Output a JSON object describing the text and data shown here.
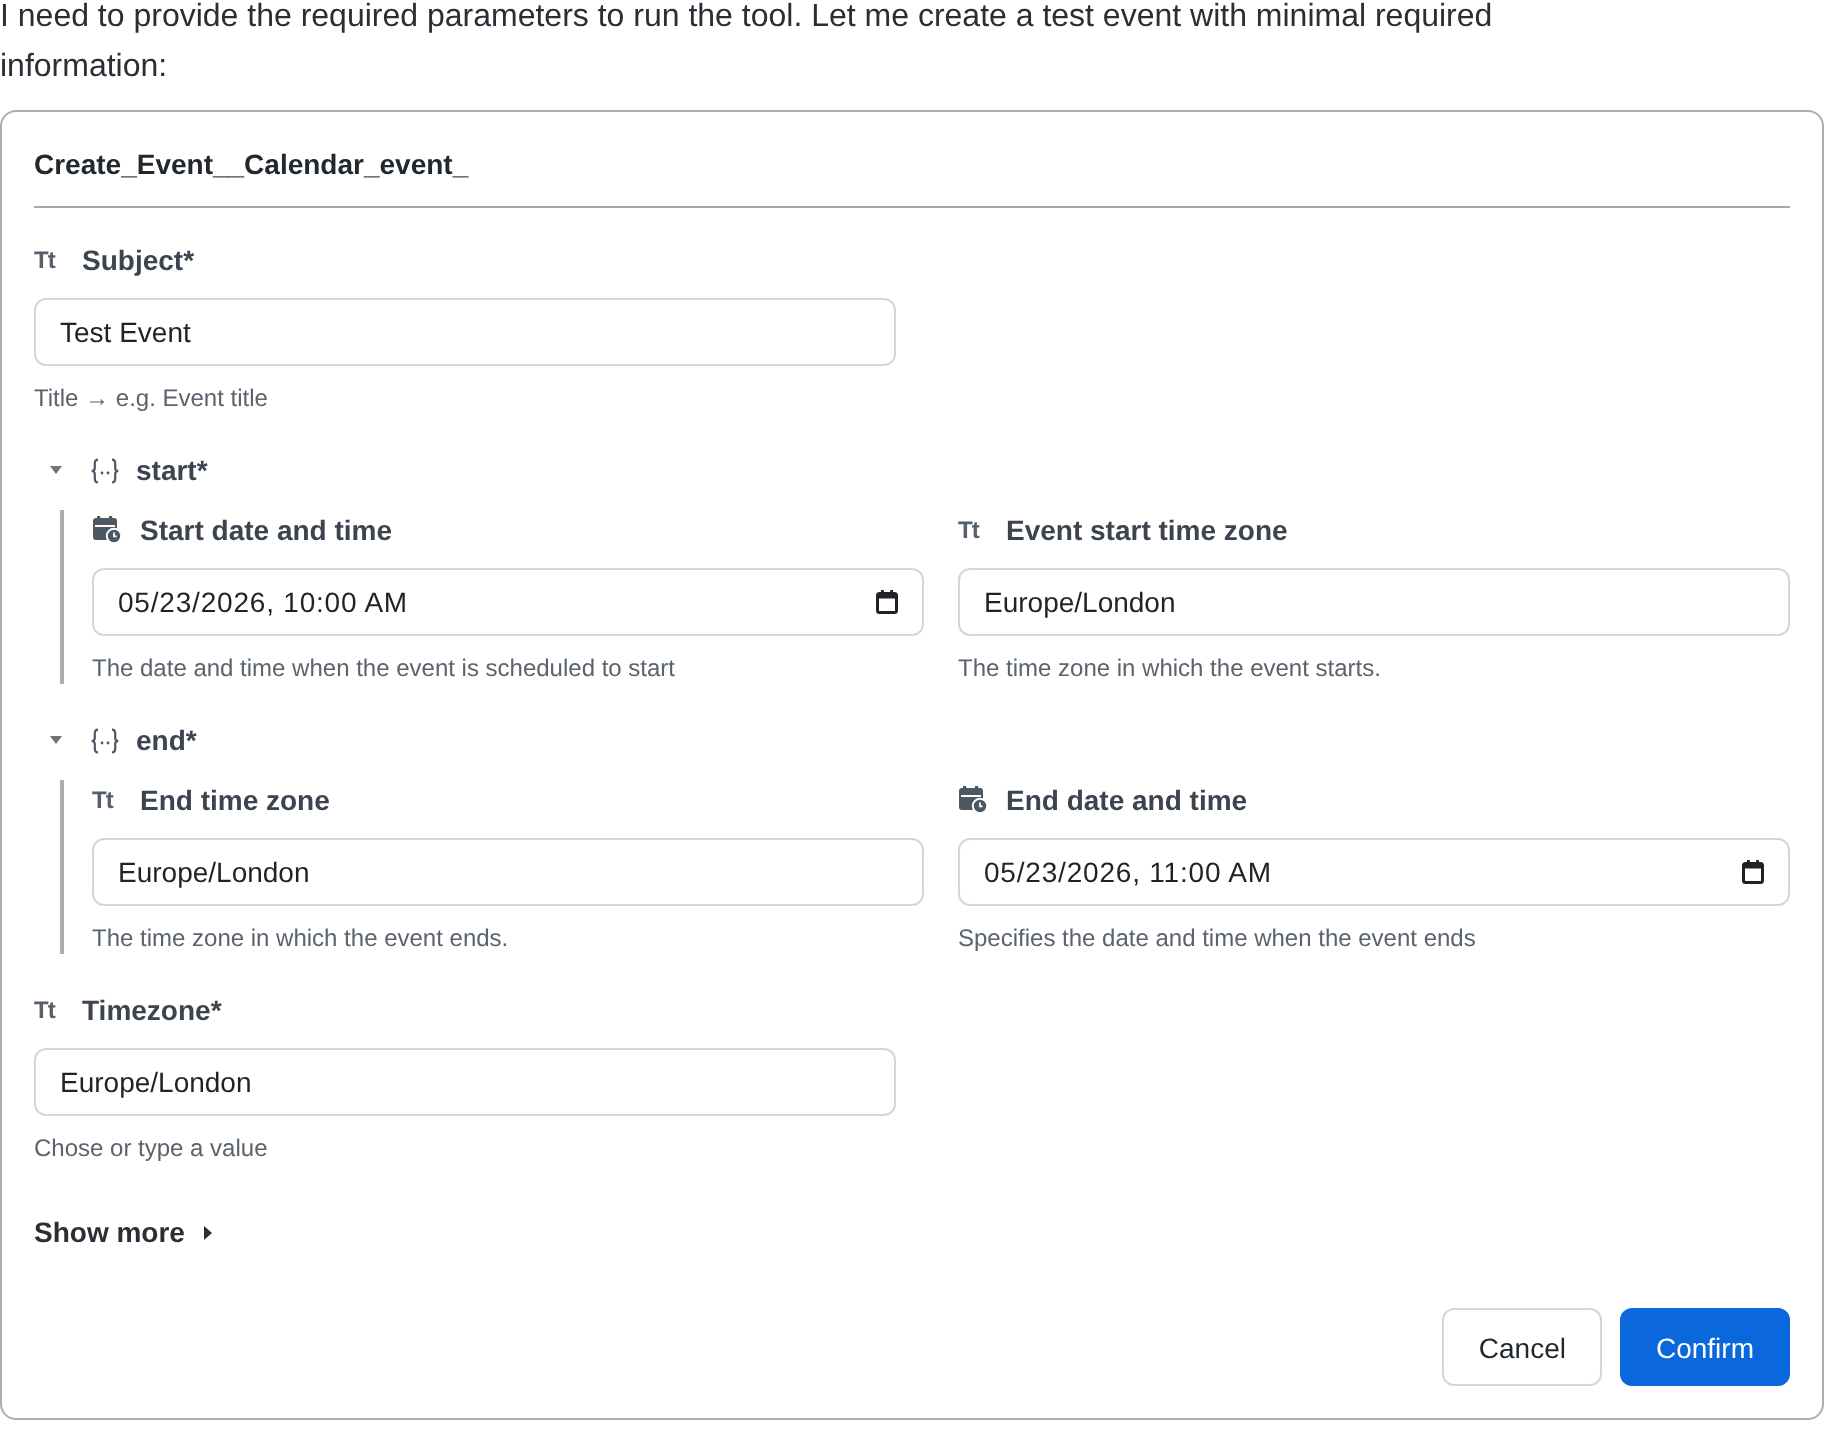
{
  "intro": "I need to provide the required parameters to run the tool. Let me create a test event with minimal required information:",
  "form": {
    "title": "Create_Event__Calendar_event_",
    "fields": [
      {
        "kind": "text",
        "type_icon": "Tt",
        "label": "Subject*",
        "value": "Test Event",
        "hint": "Title → e.g. Event title"
      },
      {
        "kind": "group",
        "label": "start*",
        "expanded": true,
        "children": [
          {
            "kind": "datetime",
            "label": "Start date and time",
            "value": "05/23/2026, 10:00 AM",
            "hint": "The date and time when the event is scheduled to start"
          },
          {
            "kind": "text",
            "type_icon": "Tt",
            "label": "Event start time zone",
            "value": "Europe/London",
            "hint": "The time zone in which the event starts."
          }
        ]
      },
      {
        "kind": "group",
        "label": "end*",
        "expanded": true,
        "children": [
          {
            "kind": "text",
            "type_icon": "Tt",
            "label": "End time zone",
            "value": "Europe/London",
            "hint": "The time zone in which the event ends."
          },
          {
            "kind": "datetime",
            "label": "End date and time",
            "value": "05/23/2026, 11:00 AM",
            "hint": "Specifies the date and time when the event ends"
          }
        ]
      },
      {
        "kind": "text",
        "type_icon": "Tt",
        "label": "Timezone*",
        "value": "Europe/London",
        "hint": "Chose or type a value"
      }
    ],
    "show_more": {
      "label": "Show more",
      "expanded": false
    },
    "buttons": [
      {
        "kind": "secondary",
        "label": "Cancel"
      },
      {
        "kind": "primary",
        "label": "Confirm"
      }
    ]
  }
}
